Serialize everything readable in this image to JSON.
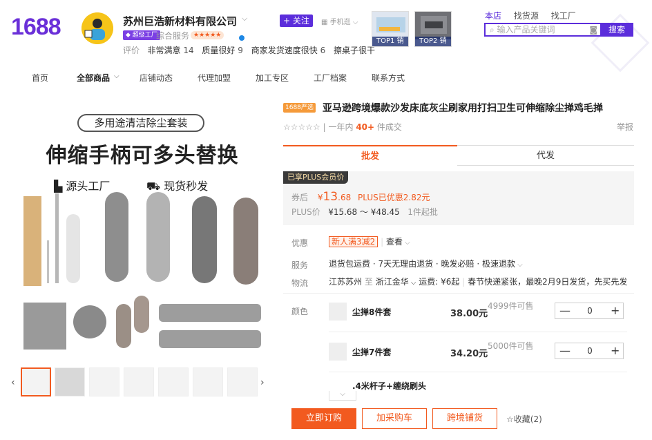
{
  "header": {
    "logo": "1688",
    "company_name": "苏州巨浩新材料有限公司",
    "factory_badge": "超级工厂",
    "overall_service_label": "综合服务",
    "stars_badge": "★★★★★",
    "reviews_label": "评价",
    "reviews": [
      {
        "label": "非常满意",
        "value": "14"
      },
      {
        "label": "质量很好",
        "value": "9"
      },
      {
        "label": "商家发货速度很快",
        "value": "6"
      },
      {
        "label": "擦桌子很干",
        "value": ""
      }
    ],
    "follow_label": "关注",
    "mobile_label": "手机逛",
    "top_cards": [
      {
        "label": "TOP1",
        "suffix": "销"
      },
      {
        "label": "TOP2",
        "suffix": "销"
      }
    ]
  },
  "search": {
    "tabs": [
      "本店",
      "找货源",
      "找工厂"
    ],
    "placeholder": "输入产品关键词",
    "button": "搜索"
  },
  "nav": [
    "首页",
    "全部商品",
    "店铺动态",
    "代理加盟",
    "加工专区",
    "工厂档案",
    "联系方式"
  ],
  "gallery": {
    "pill_text": "多用途清洁除尘套装",
    "headline": "伸缩手柄可多头替换",
    "feature_1": "源头工厂",
    "feature_2": "现货秒发",
    "prev": "‹",
    "next": "›"
  },
  "product": {
    "tag": "1688严选",
    "title": "亚马逊跨境爆款沙发床底灰尘刷家用打扫卫生可伸缩除尘掸鸡毛掸",
    "stars": "☆☆☆☆☆",
    "sales_prefix": "一年内",
    "sales_count": "40+",
    "sales_suffix": "件成交",
    "report": "举报"
  },
  "tabs": {
    "wholesale": "批发",
    "dropship": "代发"
  },
  "pricing": {
    "plus_tag": "已享PLUS会员价",
    "coupon_label": "券后",
    "coupon_currency": "¥",
    "coupon_price_int": "13",
    "coupon_price_dec": ".68",
    "plus_saving": "PLUS已优惠2.82元",
    "plus_label": "PLUS价",
    "plus_range": "¥15.68 ～ ¥48.45",
    "moq": "1件起批"
  },
  "details": {
    "promo_label": "优惠",
    "promo_coupon": "新人满3减2",
    "promo_view": "查看",
    "service_label": "服务",
    "service_text": "退货包运费 · 7天无理由退货 · 晚发必赔 · 极速退款",
    "logistics_label": "物流",
    "logistics_from": "江苏苏州",
    "logistics_to_word": "至",
    "logistics_to": "浙江金华",
    "logistics_fee": "运费: ¥6起",
    "logistics_note": "春节快递紧张，最晚2月9日发货，先买先发",
    "color_label": "颜色"
  },
  "skus": [
    {
      "name": "尘掸8件套",
      "price": "38.00元",
      "stock": "4999件可售",
      "qty": "0"
    },
    {
      "name": "尘掸7件套",
      "price": "34.20元",
      "stock": "5000件可售",
      "qty": "0"
    },
    {
      "name": ".4米杆子+缠绕刷头",
      "price": "",
      "stock": "",
      "qty": ""
    }
  ],
  "stepper": {
    "minus": "—",
    "plus": "+"
  },
  "actions": {
    "order": "立即订购",
    "cart": "加采购车",
    "cross": "跨境铺货",
    "fav_icon": "☆",
    "fav": "收藏(2)"
  }
}
